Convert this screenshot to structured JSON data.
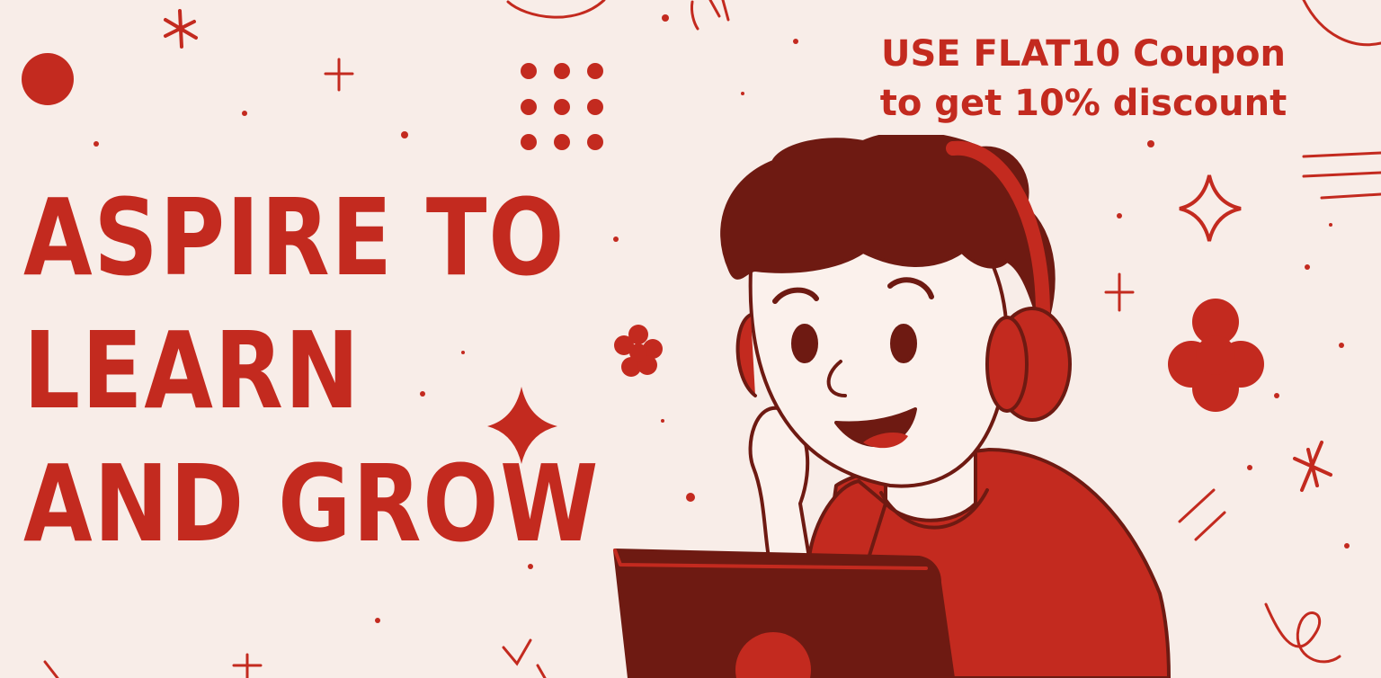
{
  "headline": {
    "line1": "ASPIRE TO",
    "line2": "LEARN",
    "line3": "AND GROW"
  },
  "coupon": {
    "line1": "USE FLAT10 Coupon",
    "line2": "to get 10% discount"
  },
  "illustration": {
    "subject": "boy-with-headphones-and-laptop"
  },
  "colors": {
    "background": "#f8ede8",
    "accent": "#c32a1f",
    "dark": "#6e1a12",
    "skin": "#fbf1ec"
  }
}
